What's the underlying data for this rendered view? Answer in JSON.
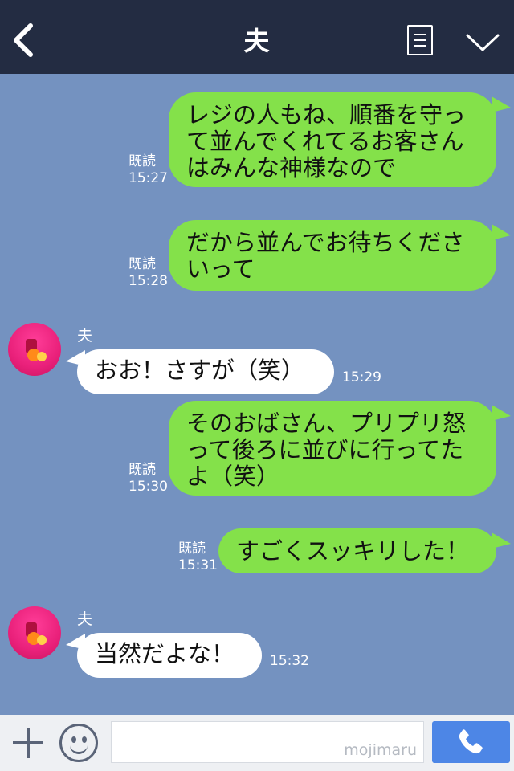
{
  "header": {
    "title": "夫"
  },
  "messages": [
    {
      "type": "sent",
      "text": "レジの人もね、順番を守って並んでくれてるお客さんはみんな神様なので",
      "read": "既読",
      "time": "15:27"
    },
    {
      "type": "sent",
      "text": "だから並んでお待ちくださいって",
      "read": "既読",
      "time": "15:28"
    },
    {
      "type": "received",
      "sender": "夫",
      "text": "おお！さすが（笑）",
      "time": "15:29"
    },
    {
      "type": "sent",
      "text": "そのおばさん、プリプリ怒って後ろに並びに行ってたよ（笑）",
      "read": "既読",
      "time": "15:30"
    },
    {
      "type": "sent",
      "text": "すごくスッキリした！",
      "read": "既読",
      "time": "15:31"
    },
    {
      "type": "received",
      "sender": "夫",
      "text": "当然だよな！",
      "time": "15:32"
    }
  ],
  "footer": {
    "watermark": "mojimaru"
  },
  "icons": {
    "back": "back-chevron-icon",
    "menu": "list-icon",
    "collapse": "chevron-down-icon",
    "add": "plus-icon",
    "emoji": "smiley-icon",
    "call": "phone-icon"
  },
  "colors": {
    "header": "#232c42",
    "chat_background": "#7492c0",
    "sent_bubble": "#84e14a",
    "received_bubble": "#ffffff",
    "call_button": "#4d86e6"
  }
}
